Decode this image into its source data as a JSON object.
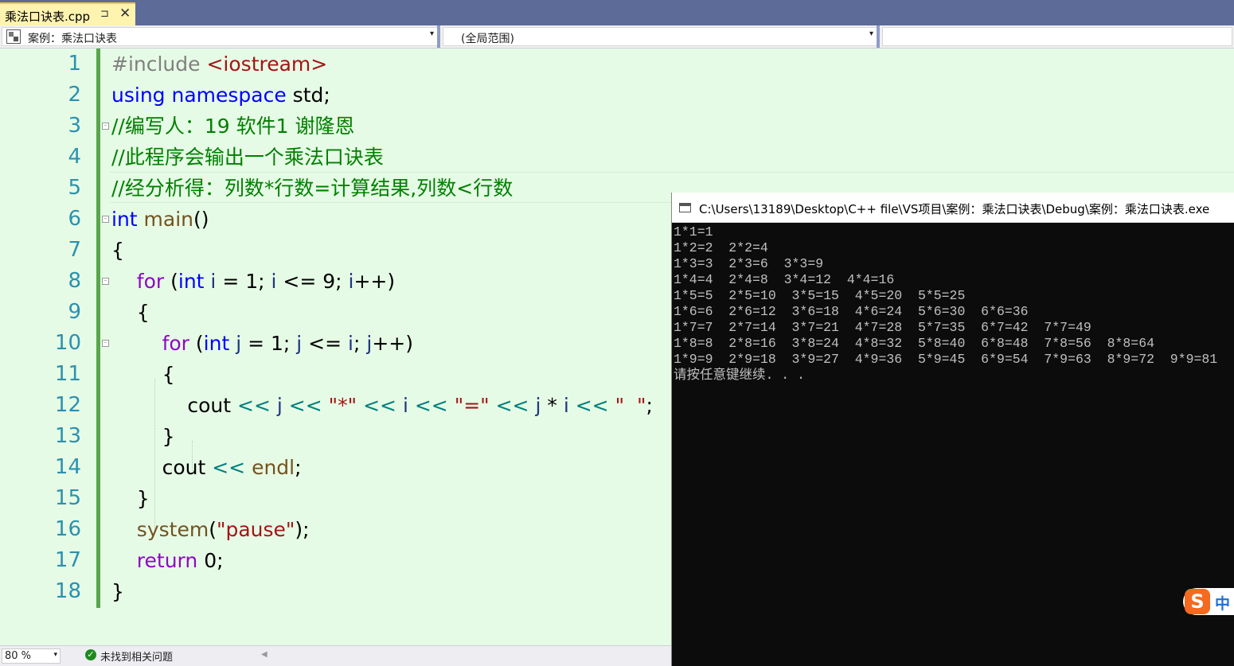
{
  "tab": {
    "title": "乘法口诀表.cpp",
    "pin": "⊐",
    "close": "✕"
  },
  "navbar": {
    "project": "案例：乘法口诀表",
    "scope": "(全局范围)",
    "arrow": "▾"
  },
  "editor": {
    "line_numbers": [
      "1",
      "2",
      "3",
      "4",
      "5",
      "6",
      "7",
      "8",
      "9",
      "10",
      "11",
      "12",
      "13",
      "14",
      "15",
      "16",
      "17",
      "18"
    ],
    "lines": [
      [
        {
          "t": "#include ",
          "c": "pp"
        },
        {
          "t": "<iostream>",
          "c": "str"
        }
      ],
      [
        {
          "t": "using",
          "c": "kw"
        },
        {
          "t": " "
        },
        {
          "t": "namespace",
          "c": "kw"
        },
        {
          "t": " std;"
        }
      ],
      [
        {
          "t": "//编写人：19 软件1 谢隆恩",
          "c": "cmt"
        }
      ],
      [
        {
          "t": "//此程序会输出一个乘法口诀表",
          "c": "cmt"
        }
      ],
      [
        {
          "t": "//经分析得：列数*行数=计算结果,列数<行数",
          "c": "cmt"
        }
      ],
      [
        {
          "t": "int",
          "c": "kw"
        },
        {
          "t": " "
        },
        {
          "t": "main",
          "c": "fn"
        },
        {
          "t": "()"
        }
      ],
      [
        {
          "t": "{"
        }
      ],
      [
        {
          "t": "    "
        },
        {
          "t": "for",
          "c": "ctl"
        },
        {
          "t": " ("
        },
        {
          "t": "int",
          "c": "kw"
        },
        {
          "t": " "
        },
        {
          "t": "i",
          "c": "var"
        },
        {
          "t": " = 1; "
        },
        {
          "t": "i",
          "c": "var"
        },
        {
          "t": " <= 9; "
        },
        {
          "t": "i",
          "c": "var"
        },
        {
          "t": "++)"
        }
      ],
      [
        {
          "t": "    {"
        }
      ],
      [
        {
          "t": "        "
        },
        {
          "t": "for",
          "c": "ctl"
        },
        {
          "t": " ("
        },
        {
          "t": "int",
          "c": "kw"
        },
        {
          "t": " "
        },
        {
          "t": "j",
          "c": "var"
        },
        {
          "t": " = 1; "
        },
        {
          "t": "j",
          "c": "var"
        },
        {
          "t": " <= "
        },
        {
          "t": "i",
          "c": "var"
        },
        {
          "t": "; "
        },
        {
          "t": "j",
          "c": "var"
        },
        {
          "t": "++)"
        }
      ],
      [
        {
          "t": "        {"
        }
      ],
      [
        {
          "t": "            cout "
        },
        {
          "t": "<<",
          "c": "op"
        },
        {
          "t": " "
        },
        {
          "t": "j",
          "c": "var"
        },
        {
          "t": " "
        },
        {
          "t": "<<",
          "c": "op"
        },
        {
          "t": " "
        },
        {
          "t": "\"*\"",
          "c": "str"
        },
        {
          "t": " "
        },
        {
          "t": "<<",
          "c": "op"
        },
        {
          "t": " "
        },
        {
          "t": "i",
          "c": "var"
        },
        {
          "t": " "
        },
        {
          "t": "<<",
          "c": "op"
        },
        {
          "t": " "
        },
        {
          "t": "\"=\"",
          "c": "str"
        },
        {
          "t": " "
        },
        {
          "t": "<<",
          "c": "op"
        },
        {
          "t": " "
        },
        {
          "t": "j",
          "c": "var"
        },
        {
          "t": " * "
        },
        {
          "t": "i",
          "c": "var"
        },
        {
          "t": " "
        },
        {
          "t": "<<",
          "c": "op"
        },
        {
          "t": " "
        },
        {
          "t": "\"  \"",
          "c": "str"
        },
        {
          "t": ";"
        }
      ],
      [
        {
          "t": "        }"
        }
      ],
      [
        {
          "t": "        cout "
        },
        {
          "t": "<<",
          "c": "op"
        },
        {
          "t": " "
        },
        {
          "t": "endl",
          "c": "fn"
        },
        {
          "t": ";"
        }
      ],
      [
        {
          "t": "    }"
        }
      ],
      [
        {
          "t": "    "
        },
        {
          "t": "system",
          "c": "fn"
        },
        {
          "t": "("
        },
        {
          "t": "\"pause\"",
          "c": "str"
        },
        {
          "t": ");"
        }
      ],
      [
        {
          "t": "    "
        },
        {
          "t": "return",
          "c": "ctl"
        },
        {
          "t": " 0;"
        }
      ],
      [
        {
          "t": "}"
        }
      ]
    ],
    "fold_marks": [
      "⁻",
      "⁻",
      "⁻",
      "⁻"
    ]
  },
  "status": {
    "zoom": "80 %",
    "zoom_arrow": "▾",
    "issues": "未找到相关问题",
    "issues_icon": "✓",
    "scroll_left": "◀"
  },
  "console": {
    "title": "C:\\Users\\13189\\Desktop\\C++ file\\VS项目\\案例：乘法口诀表\\Debug\\案例：乘法口诀表.exe",
    "output": [
      "1*1=1",
      "1*2=2  2*2=4",
      "1*3=3  2*3=6  3*3=9",
      "1*4=4  2*4=8  3*4=12  4*4=16",
      "1*5=5  2*5=10  3*5=15  4*5=20  5*5=25",
      "1*6=6  2*6=12  3*6=18  4*6=24  5*6=30  6*6=36",
      "1*7=7  2*7=14  3*7=21  4*7=28  5*7=35  6*7=42  7*7=49",
      "1*8=8  2*8=16  3*8=24  4*8=32  5*8=40  6*8=48  7*8=56  8*8=64",
      "1*9=9  2*9=18  3*9=27  4*9=36  5*9=45  6*9=54  7*9=63  8*9=72  9*9=81",
      "请按任意键继续. . ."
    ]
  },
  "ime": {
    "logo": "S",
    "mode": "中"
  }
}
